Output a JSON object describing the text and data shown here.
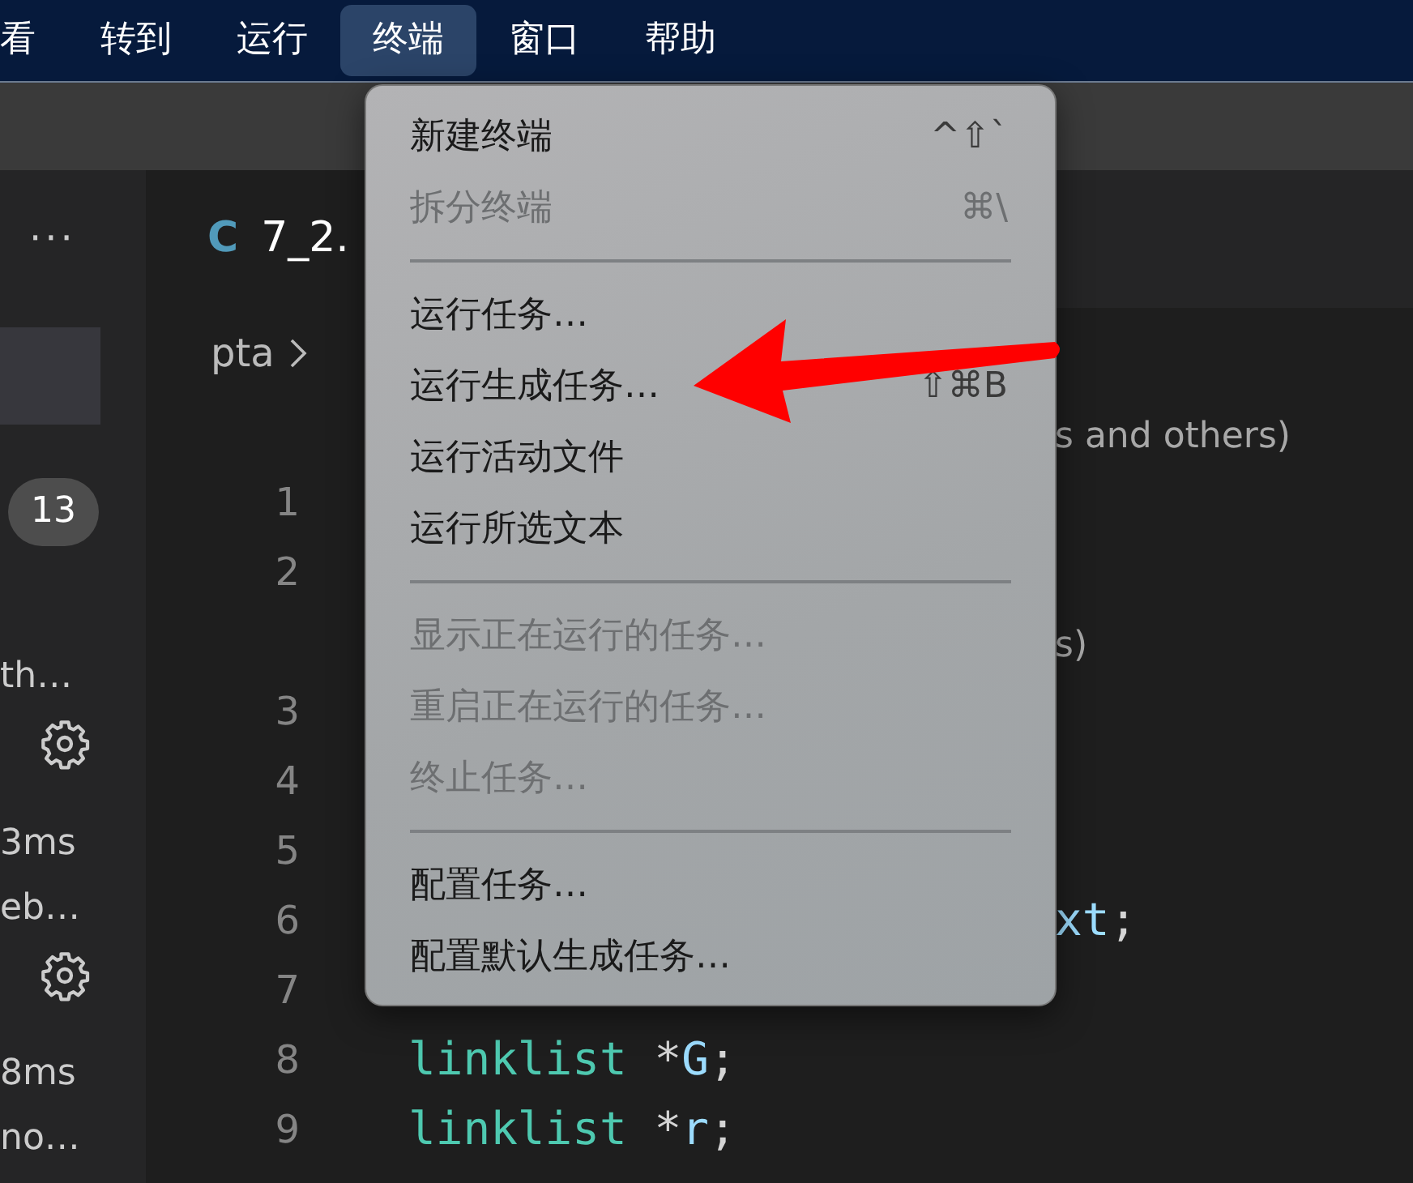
{
  "menubar": [
    {
      "label": "看",
      "selected": false
    },
    {
      "label": "转到",
      "selected": false
    },
    {
      "label": "运行",
      "selected": false
    },
    {
      "label": "终端",
      "selected": true
    },
    {
      "label": "窗口",
      "selected": false
    },
    {
      "label": "帮助",
      "selected": false
    }
  ],
  "sidebar": {
    "items": [
      {
        "kind": "more",
        "text": "···"
      },
      {
        "kind": "row",
        "selected": true
      },
      {
        "kind": "badge",
        "text": "13"
      },
      {
        "kind": "text",
        "text": "th…"
      },
      {
        "kind": "gear"
      },
      {
        "kind": "text",
        "text": "3ms"
      },
      {
        "kind": "text",
        "text": "eb…"
      },
      {
        "kind": "gear"
      },
      {
        "kind": "text",
        "text": "8ms"
      },
      {
        "kind": "text",
        "text": "no…"
      }
    ]
  },
  "editor": {
    "tab": {
      "icon_text": "C",
      "label": "7_2."
    },
    "breadcrumb": [
      "pta"
    ],
    "lines": [
      {
        "covered": true,
        "tokens": [
          {
            "kind": "hint",
            "text": "s and others)"
          }
        ]
      },
      {
        "number": "1"
      },
      {
        "number": "2"
      },
      {
        "covered": true,
        "tokens": [
          {
            "kind": "hint",
            "text": "s)"
          }
        ]
      },
      {
        "number": "3"
      },
      {
        "number": "4"
      },
      {
        "number": "5"
      },
      {
        "number": "6",
        "covered": true,
        "tokens": [
          {
            "kind": "var",
            "text": "xt"
          },
          {
            "kind": "punct",
            "text": ";"
          }
        ]
      },
      {
        "number": "7"
      },
      {
        "number": "8",
        "tokens": [
          {
            "kind": "type",
            "text": "linklist"
          },
          {
            "kind": "punct",
            "text": " *"
          },
          {
            "kind": "var",
            "text": "G"
          },
          {
            "kind": "punct",
            "text": ";"
          }
        ]
      },
      {
        "number": "9",
        "tokens": [
          {
            "kind": "type",
            "text": "linklist"
          },
          {
            "kind": "punct",
            "text": " *"
          },
          {
            "kind": "var",
            "text": "r"
          },
          {
            "kind": "punct",
            "text": ";"
          }
        ]
      }
    ]
  },
  "menu": {
    "items": [
      {
        "kind": "item",
        "label": "新建终端",
        "shortcut": "^⇧`",
        "disabled": false
      },
      {
        "kind": "item",
        "label": "拆分终端",
        "shortcut": "⌘\\",
        "disabled": true
      },
      {
        "kind": "separator"
      },
      {
        "kind": "item",
        "label": "运行任务…",
        "disabled": false
      },
      {
        "kind": "item",
        "label": "运行生成任务…",
        "shortcut": "⇧⌘B",
        "disabled": false
      },
      {
        "kind": "item",
        "label": "运行活动文件",
        "disabled": false
      },
      {
        "kind": "item",
        "label": "运行所选文本",
        "disabled": false
      },
      {
        "kind": "separator"
      },
      {
        "kind": "item",
        "label": "显示正在运行的任务…",
        "disabled": true
      },
      {
        "kind": "item",
        "label": "重启正在运行的任务…",
        "disabled": true
      },
      {
        "kind": "item",
        "label": "终止任务…",
        "disabled": true
      },
      {
        "kind": "separator"
      },
      {
        "kind": "item",
        "label": "配置任务…",
        "disabled": false
      },
      {
        "kind": "item",
        "label": "配置默认生成任务…",
        "disabled": false
      }
    ]
  },
  "annotations": [
    {
      "kind": "arrow"
    }
  ]
}
